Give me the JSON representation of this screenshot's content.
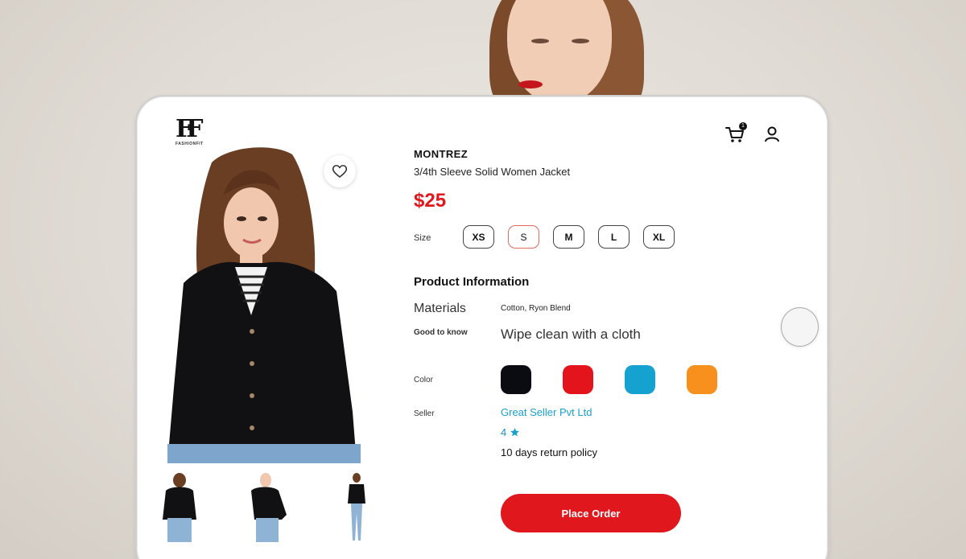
{
  "header": {
    "logo_mark": "FF",
    "logo_word": "FASHIONFIT",
    "cart_count": "1"
  },
  "product": {
    "brand": "MONTREZ",
    "name": "3/4th Sleeve Solid Women Jacket",
    "price": "$25",
    "size_label": "Size",
    "sizes": [
      "XS",
      "S",
      "M",
      "L",
      "XL"
    ],
    "selected_size": "S"
  },
  "info": {
    "title": "Product Information",
    "materials_label": "Materials",
    "materials_value": "Cotton, Ryon Blend",
    "good_to_know_label": "Good to know",
    "good_to_know_value": "Wipe clean with a cloth",
    "color_label": "Color",
    "colors": [
      "#0b0b12",
      "#e3141c",
      "#16a2d0",
      "#f8901e"
    ],
    "seller_label": "Seller",
    "seller_name": "Great Seller Pvt Ltd",
    "rating": "4",
    "return_policy": "10 days return policy"
  },
  "actions": {
    "place_order": "Place Order"
  },
  "colors": {
    "accent": "#e0171d",
    "link": "#1aa0cf"
  }
}
